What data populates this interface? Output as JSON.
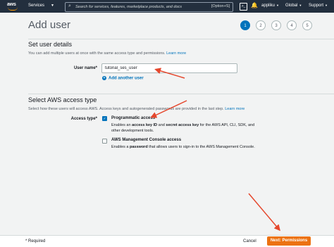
{
  "topbar": {
    "logo": "aws",
    "services_label": "Services",
    "search_placeholder": "Search for services, features, marketplace products, and docs",
    "search_shortcut": "[Option+S]",
    "account": "appliku",
    "region": "Global",
    "support": "Support"
  },
  "page": {
    "title": "Add user",
    "steps": [
      "1",
      "2",
      "3",
      "4",
      "5"
    ],
    "active_step": 1
  },
  "details": {
    "title": "Set user details",
    "description": "You can add multiple users at once with the same access type and permissions.",
    "learn_more": "Learn more",
    "username_label": "User name*",
    "username_value": "tutorial_ses_user",
    "add_another": "Add another user"
  },
  "access": {
    "title": "Select AWS access type",
    "description": "Select how these users will access AWS. Access keys and autogenerated passwords are provided in the last step.",
    "learn_more": "Learn more",
    "type_label": "Access type*",
    "programmatic": {
      "title": "Programmatic access",
      "desc_prefix": "Enables an ",
      "desc_bold1": "access key ID",
      "desc_mid": " and ",
      "desc_bold2": "secret access key",
      "desc_suffix": " for the AWS API, CLI, SDK, and",
      "desc_line2": "other development tools.",
      "checked": true
    },
    "console": {
      "title": "AWS Management Console access",
      "desc_prefix": "Enables a ",
      "desc_bold": "password",
      "desc_suffix": " that allows users to sign-in to the AWS Management Console.",
      "checked": false
    }
  },
  "footer": {
    "required": "* Required",
    "cancel": "Cancel",
    "next": "Next: Permissions"
  },
  "colors": {
    "nav_bg": "#232f3e",
    "accent_blue": "#0073bb",
    "primary_orange": "#ec7211",
    "annotation_red": "#e5472d"
  },
  "icons": [
    "search-icon",
    "cloudshell-icon",
    "bell-icon",
    "plus-icon",
    "check-icon",
    "arrow-annotation"
  ]
}
